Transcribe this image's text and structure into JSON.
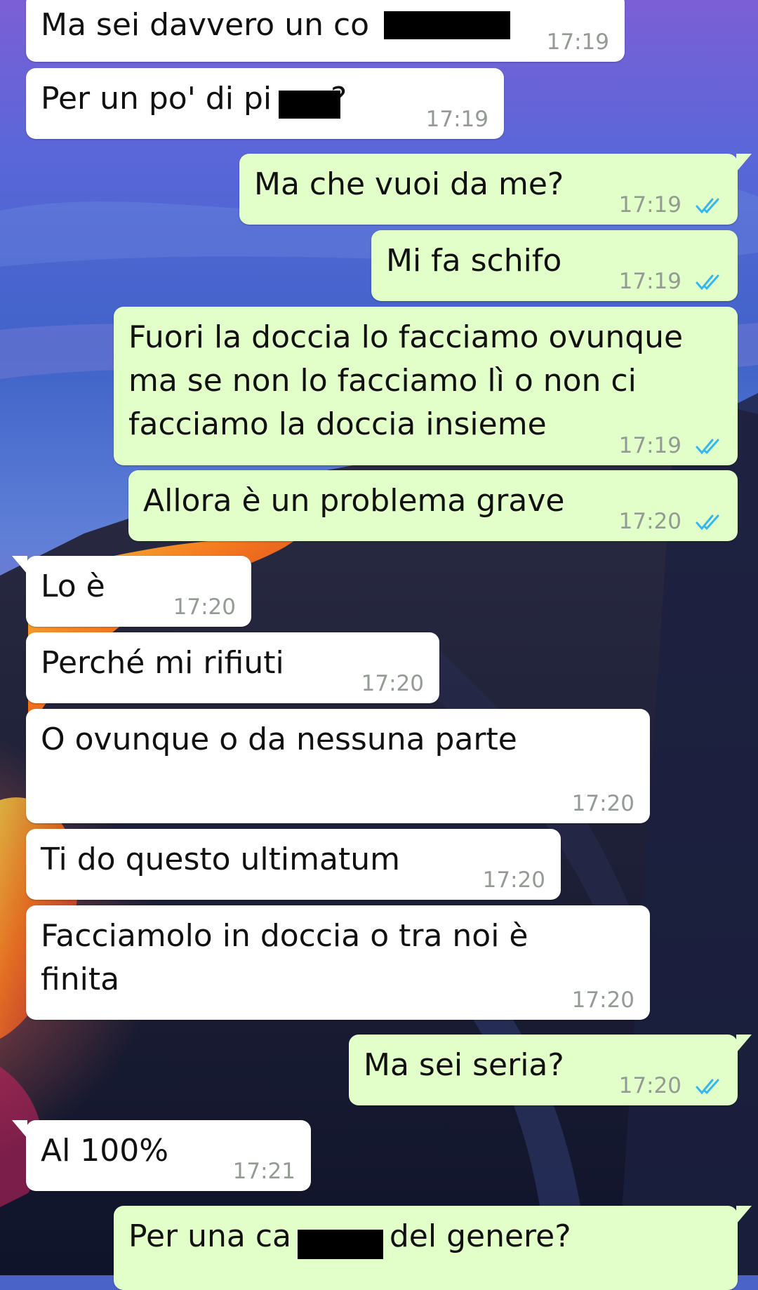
{
  "colors": {
    "incoming_bubble": "#ffffff",
    "outgoing_bubble": "#e2fec9",
    "timestamp": "#949b94",
    "read_ticks": "#34b7f1"
  },
  "icons": {
    "read_receipt": "double-check-icon"
  },
  "messages": [
    {
      "direction": "in",
      "text": "Ma sei davvero un co",
      "time": "17:19"
    },
    {
      "direction": "in",
      "text": "Per un po' di pi      ?",
      "time": "17:19"
    },
    {
      "direction": "out",
      "text": "Ma che vuoi da me?",
      "time": "17:19"
    },
    {
      "direction": "out",
      "text": "Mi fa schifo",
      "time": "17:19"
    },
    {
      "direction": "out",
      "text": "Fuori la doccia lo facciamo ovunque\nma se non lo facciamo lì o non ci\nfacciamo la doccia insieme",
      "time": "17:19"
    },
    {
      "direction": "out",
      "text": "Allora è un problema grave",
      "time": "17:20"
    },
    {
      "direction": "in",
      "text": "Lo è",
      "time": "17:20"
    },
    {
      "direction": "in",
      "text": "Perché mi rifiuti",
      "time": "17:20"
    },
    {
      "direction": "in",
      "text": "O ovunque o da nessuna parte",
      "time": "17:20"
    },
    {
      "direction": "in",
      "text": "Ti do questo ultimatum",
      "time": "17:20"
    },
    {
      "direction": "in",
      "text": "Facciamolo in doccia o tra noi è\nfinita",
      "time": "17:20"
    },
    {
      "direction": "out",
      "text": "Ma sei seria?",
      "time": "17:20"
    },
    {
      "direction": "in",
      "text": "Al 100%",
      "time": "17:21"
    },
    {
      "direction": "out",
      "text": "Per una ca          del genere?",
      "time": ""
    }
  ]
}
